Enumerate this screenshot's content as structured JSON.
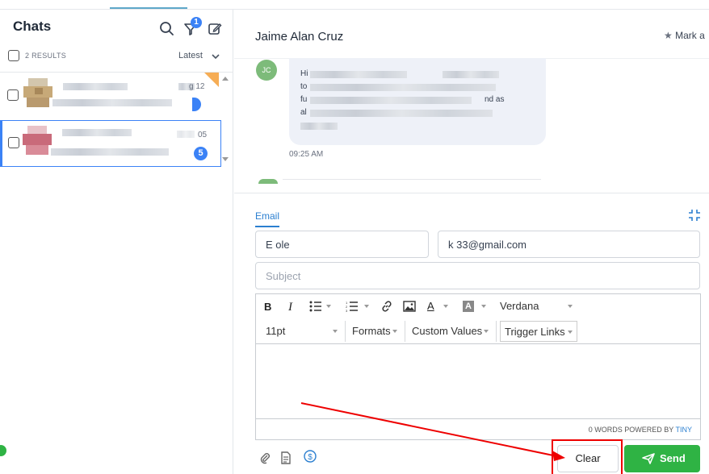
{
  "left": {
    "title": "Chats",
    "filter_badge": "1",
    "results": "2 RESULTS",
    "sort_label": "Latest",
    "items": [
      {
        "date": "g 12",
        "unread": ""
      },
      {
        "date": "05",
        "unread": "5"
      }
    ]
  },
  "conversation": {
    "contact_name": "Jaime Alan Cruz",
    "mark_as": "Mark a",
    "avatar_initials": "JC",
    "message_lines": [
      "Hi",
      "to",
      "fu",
      "nd as",
      "al"
    ],
    "message_time": "09:25 AM"
  },
  "composer": {
    "channel_tab": "Email",
    "from_value": "E            ole",
    "to_value": "k                  33@gmail.com",
    "subject_placeholder": "Subject",
    "toolbar": {
      "bold": "B",
      "italic": "I",
      "font_family": "Verdana",
      "font_size": "11pt",
      "formats": "Formats",
      "custom_values": "Custom Values",
      "trigger_links": "Trigger Links"
    },
    "word_count": "0 WORDS POWERED BY",
    "powered_by": "TINY",
    "clear_label": "Clear",
    "send_label": "Send"
  },
  "colors": {
    "accent": "#3b82f6",
    "send": "#2fb344",
    "annotation": "#ee0000",
    "link": "#2b7fd0"
  }
}
